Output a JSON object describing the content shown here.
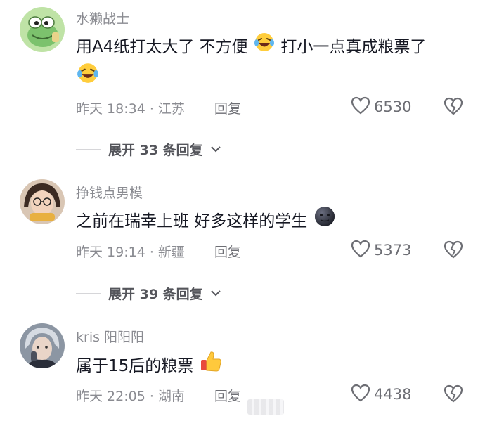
{
  "comments": [
    {
      "username": "水獭战士",
      "text_parts": [
        "用A4纸打太大了 不方便",
        "打小一点真成粮票了"
      ],
      "time_location": "昨天 18:34 · 江苏",
      "reply_label": "回复",
      "likes": "6530",
      "expand_label": "展开 33 条回复"
    },
    {
      "username": "挣钱点男模",
      "text_parts": [
        "之前在瑞幸上班 好多这样的学生"
      ],
      "time_location": "昨天 19:14 · 新疆",
      "reply_label": "回复",
      "likes": "5373",
      "expand_label": "展开 39 条回复"
    },
    {
      "username": "kris 阳阳阳",
      "text_parts": [
        "属于15后的粮票"
      ],
      "time_location": "昨天 22:05 · 湖南",
      "reply_label": "回复",
      "likes": "4438"
    }
  ],
  "icons": {
    "like": "heart-outline-icon",
    "dislike": "broken-heart-icon",
    "expand": "chevron-down-icon",
    "emoji_laugh": "laughing-tears-emoji",
    "emoji_dark": "dark-moon-face-emoji",
    "emoji_thumb": "thumbs-up-emoji"
  },
  "colors": {
    "text": "#161823",
    "secondary": "#8a8b91",
    "divider": "#d6d6d9"
  }
}
